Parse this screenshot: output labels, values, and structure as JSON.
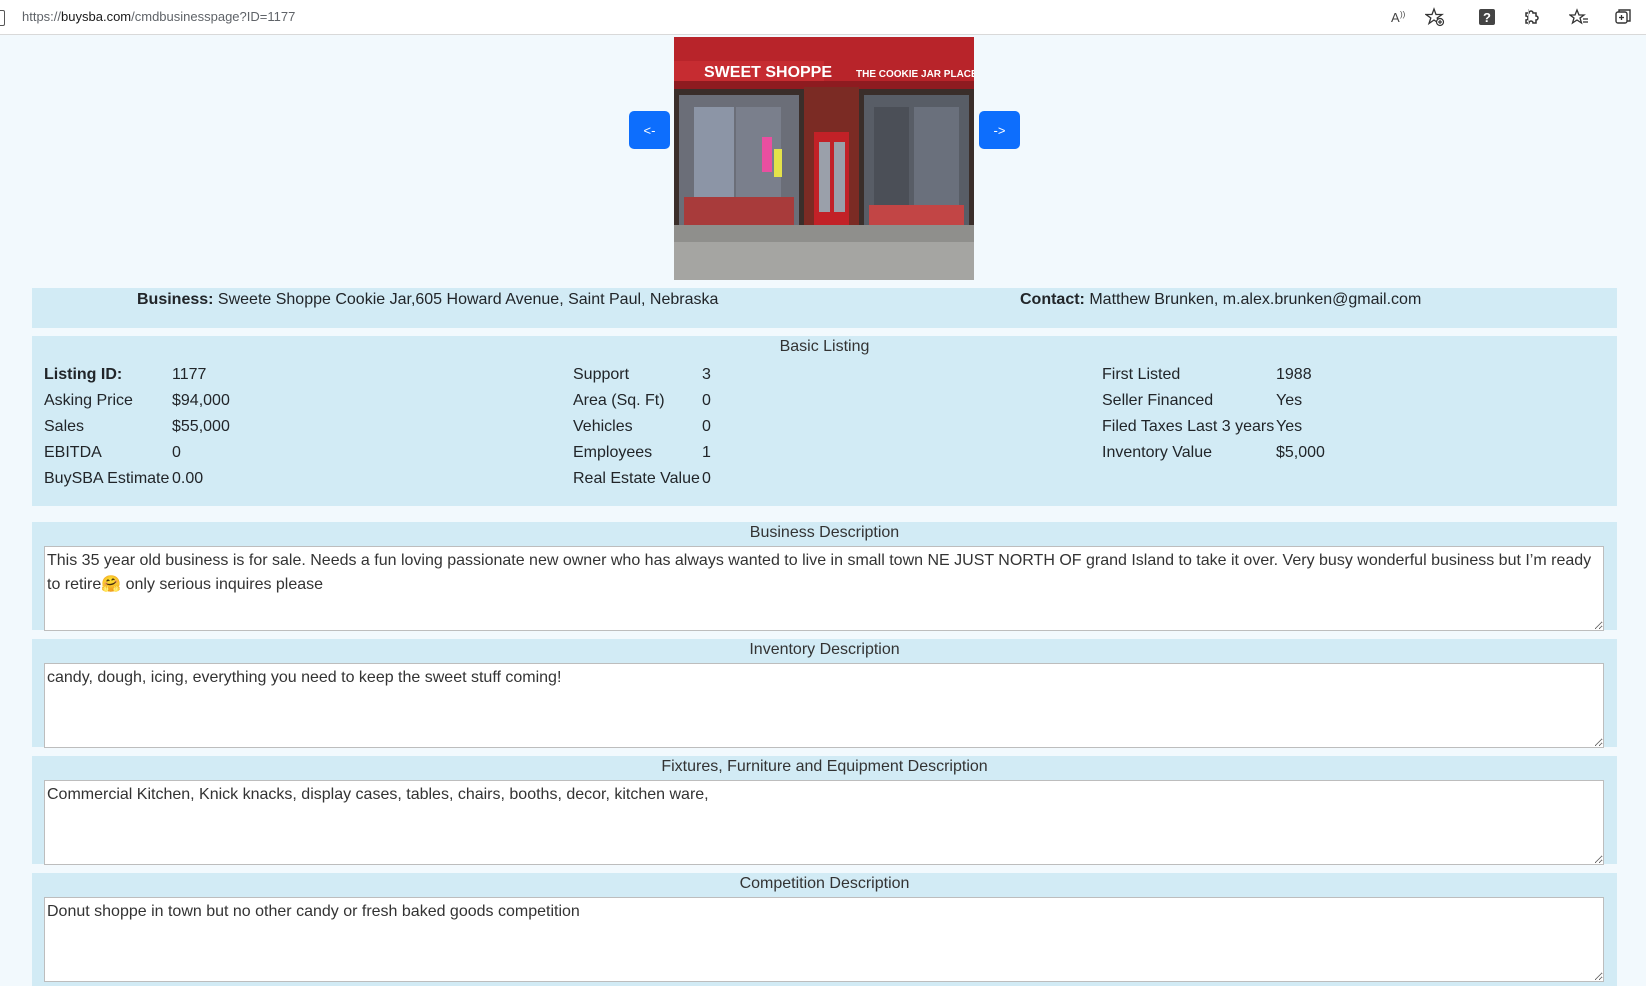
{
  "browser": {
    "url_prefix": "https://",
    "url_domain": "buysba.com",
    "url_path": "/cmdbusinesspage?ID=1177",
    "icons": [
      "read-aloud-icon",
      "favorite-add-icon",
      "help-icon",
      "extensions-icon",
      "favorites-icon",
      "collections-icon"
    ]
  },
  "carousel": {
    "prev_label": "<-",
    "next_label": "->",
    "awning_left_text": "SWEET SHOPPE",
    "awning_right_text": "THE COOKIE JAR PLACE"
  },
  "business": {
    "label": "Business:",
    "value": "Sweete Shoppe Cookie Jar,605 Howard Avenue, Saint Paul, Nebraska",
    "contact_label": "Contact:",
    "contact_value": "Matthew Brunken, m.alex.brunken@gmail.com"
  },
  "basic_listing": {
    "title": "Basic Listing",
    "col1": [
      {
        "label": "Listing ID:",
        "value": "1177"
      },
      {
        "label": "Asking Price",
        "value": "$94,000"
      },
      {
        "label": "Sales",
        "value": "$55,000"
      },
      {
        "label": "EBITDA",
        "value": "0"
      },
      {
        "label": "BuySBA Estimate",
        "value": "0.00"
      }
    ],
    "col2": [
      {
        "label": "Support",
        "value": "3"
      },
      {
        "label": "Area (Sq. Ft)",
        "value": "0"
      },
      {
        "label": "Vehicles",
        "value": "0"
      },
      {
        "label": "Employees",
        "value": "1"
      },
      {
        "label": "Real Estate Value",
        "value": "0"
      }
    ],
    "col3": [
      {
        "label": "First Listed",
        "value": "1988"
      },
      {
        "label": "Seller Financed",
        "value": "Yes"
      },
      {
        "label": "Filed Taxes Last 3 years",
        "value": "Yes"
      },
      {
        "label": "Inventory Value",
        "value": "$5,000"
      }
    ]
  },
  "descriptions": {
    "business": {
      "title": "Business Description",
      "text": "This 35 year old business is for sale. Needs a fun loving passionate new owner who has always wanted to live in small town NE JUST NORTH OF grand Island to take it over. Very busy wonderful business but I’m ready to retire🤗 only serious inquires please"
    },
    "inventory": {
      "title": "Inventory Description",
      "text": "candy, dough, icing, everything you need to keep the sweet stuff coming!"
    },
    "fixtures": {
      "title": "Fixtures, Furniture and Equipment Description",
      "text": "Commercial Kitchen, Knick knacks, display cases, tables, chairs, booths, decor, kitchen ware,"
    },
    "competition": {
      "title": "Competition Description",
      "text": "Donut shoppe in town but no other candy or fresh baked goods competition"
    }
  }
}
